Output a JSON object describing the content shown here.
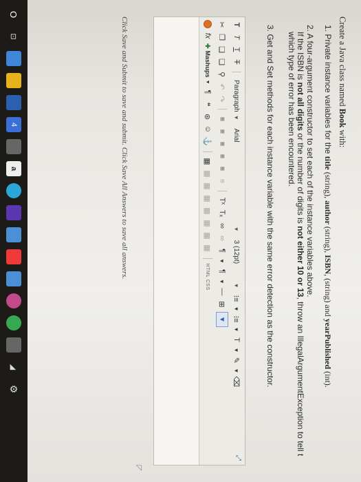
{
  "question": {
    "intro_prefix": "Create a Java class named ",
    "intro_bold": "Book",
    "intro_suffix": " with:",
    "item1": {
      "text_a": "1. Private instance variables for the ",
      "title_bold": "title",
      "text_b": " (string), ",
      "author_bold": "author",
      "text_c": " (string), ",
      "isbn_bold": "ISBN",
      "text_d": ", (string) and ",
      "year_bold": "yearPublished",
      "text_e": " (int)."
    },
    "item2": {
      "line1": "2. A four-argument constructor to set each of the instance variables above.",
      "line2_a": "If the ISBN is ",
      "line2_bold1": "not all digits",
      "line2_b": " or the number of digits is ",
      "line2_bold2": "not either 10 or 13",
      "line2_c": ", throw an IllegalArgumentException to tell t",
      "line3": "which type of error has been encountered."
    },
    "item3": "3. Get and Set methods for each instance variable with the same error detection as the constructor."
  },
  "editor": {
    "paragraph_select": "Paragraph",
    "font_select": "Arial",
    "size_select": "3 (12pt)",
    "mashups_label": "Mashups",
    "html_css_label": "HTML  CSS",
    "fx_label": "fx",
    "resize_grip": "◸"
  },
  "footer_note": "Click Save and Submit to save and submit. Click Save All Answers to save all answers.",
  "taskbar": {
    "start": "O",
    "search": "",
    "task_view": "⊡",
    "badge_4": "4",
    "app_a": "a"
  },
  "icons": {
    "bold": "T",
    "italic": "T",
    "underline": "T",
    "strike": "T",
    "cut": "✂",
    "copy": "❐",
    "paste": "❑",
    "search": "⚲",
    "undo": "↶",
    "redo": "↷",
    "align": "≡",
    "list": "⁝≡",
    "text_color": "T",
    "brush": "✎",
    "link": "∞",
    "pilcrow": "¶",
    "quote": "❝",
    "omega": "⊛",
    "emoji": "☺",
    "anchor": "⚓",
    "table": "▦",
    "superscript": "Tˣ",
    "subscript": "Tₓ",
    "eraser": "⌫",
    "hr": "—",
    "special": "⊞",
    "fullscreen": "⤢"
  }
}
